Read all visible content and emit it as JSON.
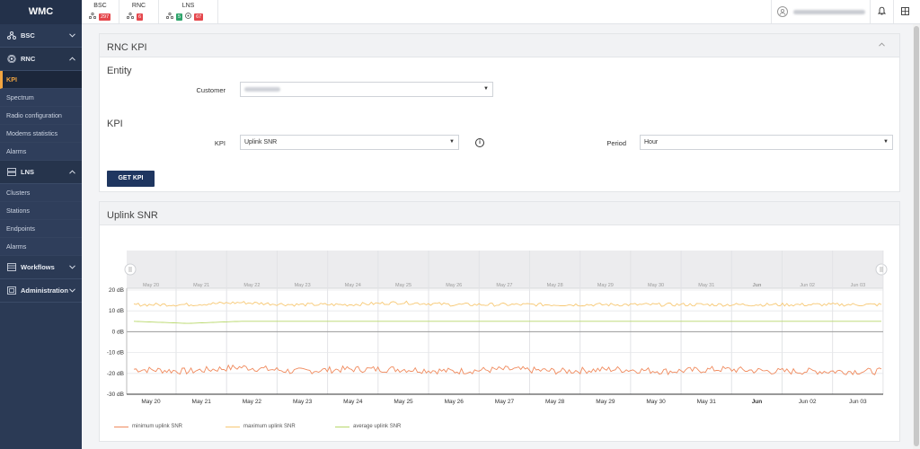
{
  "brand": "WMC",
  "sidebar": {
    "groups": [
      {
        "label": "BSC",
        "icon": "network-icon",
        "chevron": "⌄"
      },
      {
        "label": "RNC",
        "icon": "radio-icon",
        "chevron": "⌃"
      },
      {
        "label": "LNS",
        "icon": "server-icon",
        "chevron": "⌃"
      },
      {
        "label": "Workflows",
        "icon": "workflow-icon",
        "chevron": "⌄"
      },
      {
        "label": "Administration",
        "icon": "admin-icon",
        "chevron": "⌄"
      }
    ],
    "rnc_items": [
      "KPI",
      "Spectrum",
      "Radio configuration",
      "Modems statistics",
      "Alarms"
    ],
    "lns_items": [
      "Clusters",
      "Stations",
      "Endpoints",
      "Alarms"
    ]
  },
  "topbar": {
    "bsc": {
      "title": "BSC",
      "count": "297"
    },
    "rnc": {
      "title": "RNC",
      "count": "6"
    },
    "lns": {
      "title": "LNS",
      "green": "5",
      "red": "67"
    }
  },
  "kpi_panel": {
    "title": "RNC KPI",
    "entity_title": "Entity",
    "customer_label": "Customer",
    "kpi_title": "KPI",
    "kpi_label": "KPI",
    "kpi_value": "Uplink SNR",
    "period_label": "Period",
    "period_value": "Hour",
    "button": "GET KPI"
  },
  "chart_panel": {
    "title": "Uplink SNR"
  },
  "colors": {
    "min": "#f08a5d",
    "max": "#f7c873",
    "avg": "#b8d86b",
    "accent": "#f2a541",
    "sidebar": "#2b3a55"
  },
  "chart_data": {
    "type": "line",
    "x": [
      "May 20",
      "May 21",
      "May 22",
      "May 23",
      "May 24",
      "May 25",
      "May 26",
      "May 27",
      "May 28",
      "May 29",
      "May 30",
      "May 31",
      "Jun",
      "Jun 02",
      "Jun 03"
    ],
    "xlabel": "",
    "ylabel": "",
    "ylim": [
      -30,
      20
    ],
    "y_ticks": [
      "20 dB",
      "10 dB",
      "0 dB",
      "-10 dB",
      "-20 dB",
      "-30 dB"
    ],
    "grid": true,
    "legend_position": "bottom-left",
    "series": [
      {
        "name": "minimum uplink SNR",
        "values": [
          -18,
          -19,
          -17,
          -19,
          -18,
          -18,
          -19,
          -18,
          -19,
          -18,
          -19,
          -18,
          -19,
          -19,
          -19
        ]
      },
      {
        "name": "maximum uplink SNR",
        "values": [
          13,
          13,
          14,
          13,
          13,
          14,
          13,
          13,
          13,
          13,
          13,
          13,
          13,
          13,
          13
        ]
      },
      {
        "name": "average uplink SNR",
        "values": [
          5,
          4,
          5,
          5,
          5,
          5,
          5,
          5,
          5,
          5,
          5,
          5,
          5,
          5,
          5
        ]
      }
    ]
  }
}
